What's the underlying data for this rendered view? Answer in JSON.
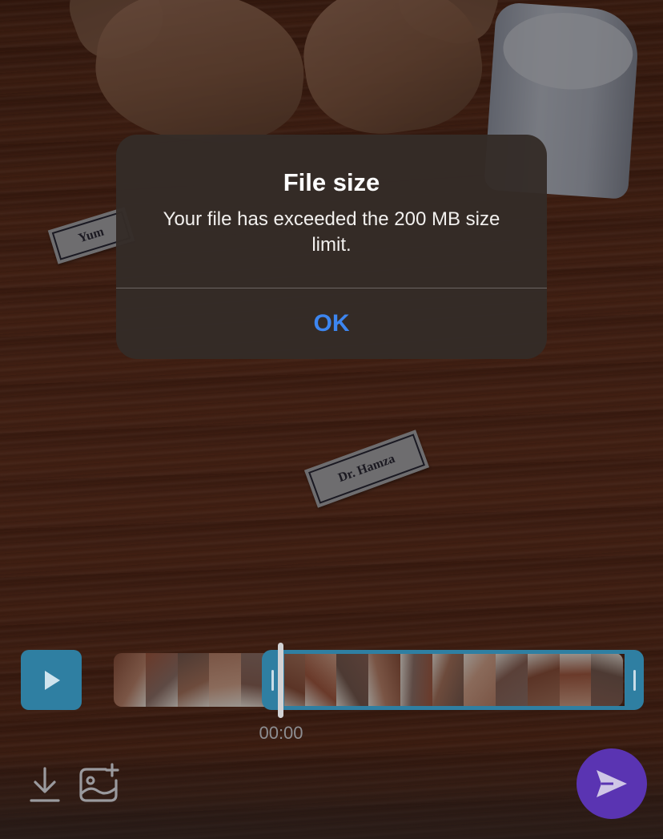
{
  "dialog": {
    "title": "File size",
    "message": "Your file has exceeded the 200 MB size limit.",
    "ok_label": "OK"
  },
  "background": {
    "card_left_text": "Yum",
    "card_center_text": "Dr. Hamza"
  },
  "timeline": {
    "current_time": "00:00",
    "frame_count": 16
  },
  "toolbar": {
    "download_icon": "download-icon",
    "gallery_icon": "add-image-icon",
    "send_icon": "send-icon"
  },
  "colors": {
    "accent_blue": "#3d86f0",
    "trim_blue": "#2f7fa2",
    "send_purple": "#5a34b2",
    "dialog_bg": "#342c28"
  }
}
